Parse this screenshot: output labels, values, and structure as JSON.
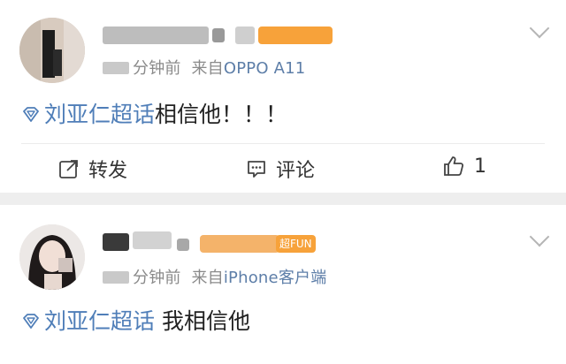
{
  "posts": [
    {
      "meta_time_blurred": "██分钟前",
      "meta_time": "分钟前",
      "meta_source_prefix": "来自",
      "meta_source": "OPPO A11",
      "topic": "刘亚仁超话",
      "text": "相信他！！！",
      "actions": {
        "repost": "转发",
        "comment": "评论",
        "like": "1"
      }
    },
    {
      "meta_time": "分钟前",
      "meta_source_prefix": "来自",
      "meta_source": "iPhone客户端",
      "badge_label": "超FUN",
      "topic": "刘亚仁超话",
      "text": "我相信他"
    }
  ],
  "colors": {
    "topic_link": "#4f7eb8",
    "badge_orange": "#f7a23a",
    "separator": "#eeeeee"
  }
}
